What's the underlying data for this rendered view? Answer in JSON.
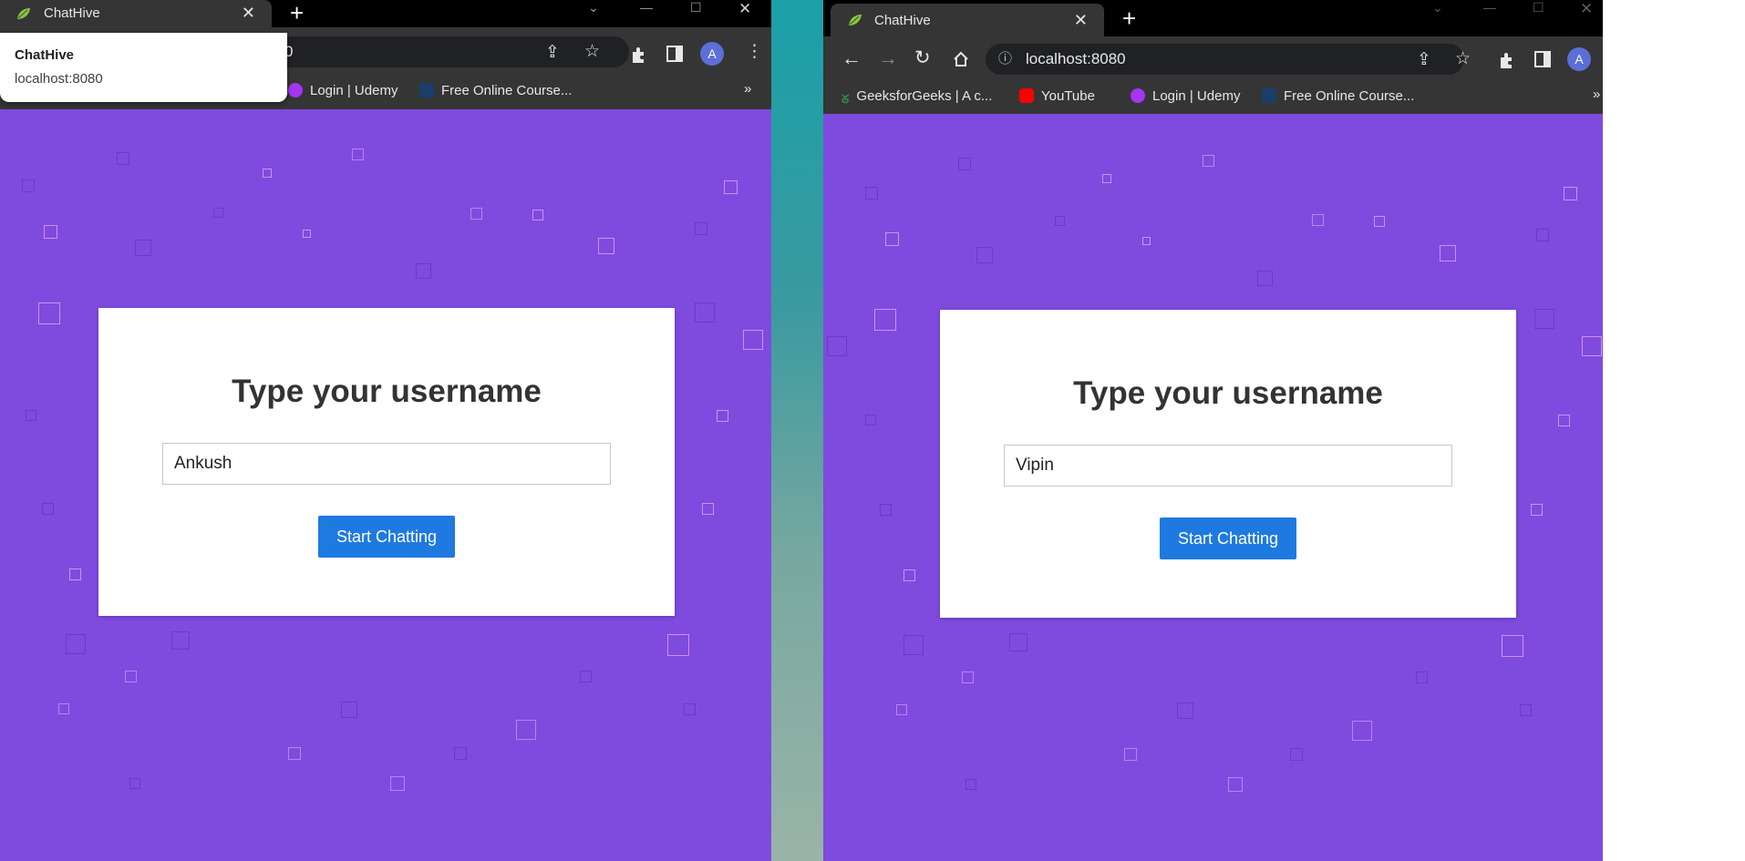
{
  "left_window": {
    "tab_title": "ChatHive",
    "tab_close": "✕",
    "new_tab": "+",
    "popup": {
      "title": "ChatHive",
      "url": "localhost:8080"
    },
    "omnibox_visible": "0",
    "bookmarks": [
      {
        "label": "Login | Udemy",
        "icon": "udemy-icon"
      },
      {
        "label": "Free Online Course...",
        "icon": "translate-icon"
      }
    ],
    "overflow": "»",
    "avatar": "A",
    "form": {
      "title": "Type your username",
      "username": "Ankush",
      "button": "Start Chatting"
    }
  },
  "right_window": {
    "tab_title": "ChatHive",
    "tab_close": "✕",
    "new_tab": "+",
    "url": "localhost:8080",
    "bookmarks": [
      {
        "label": "GeeksforGeeks | A c...",
        "icon": "gfg-icon"
      },
      {
        "label": "YouTube",
        "icon": "youtube-icon"
      },
      {
        "label": "Login | Udemy",
        "icon": "udemy-icon"
      },
      {
        "label": "Free Online Course...",
        "icon": "translate-icon"
      }
    ],
    "overflow": "»",
    "avatar": "A",
    "form": {
      "title": "Type your username",
      "username": "Vipin",
      "button": "Start Chatting"
    }
  },
  "colors": {
    "page_background": "#7e4bde",
    "button": "#1e7ae0",
    "toolbar": "#353535",
    "tabstrip": "#000000"
  }
}
